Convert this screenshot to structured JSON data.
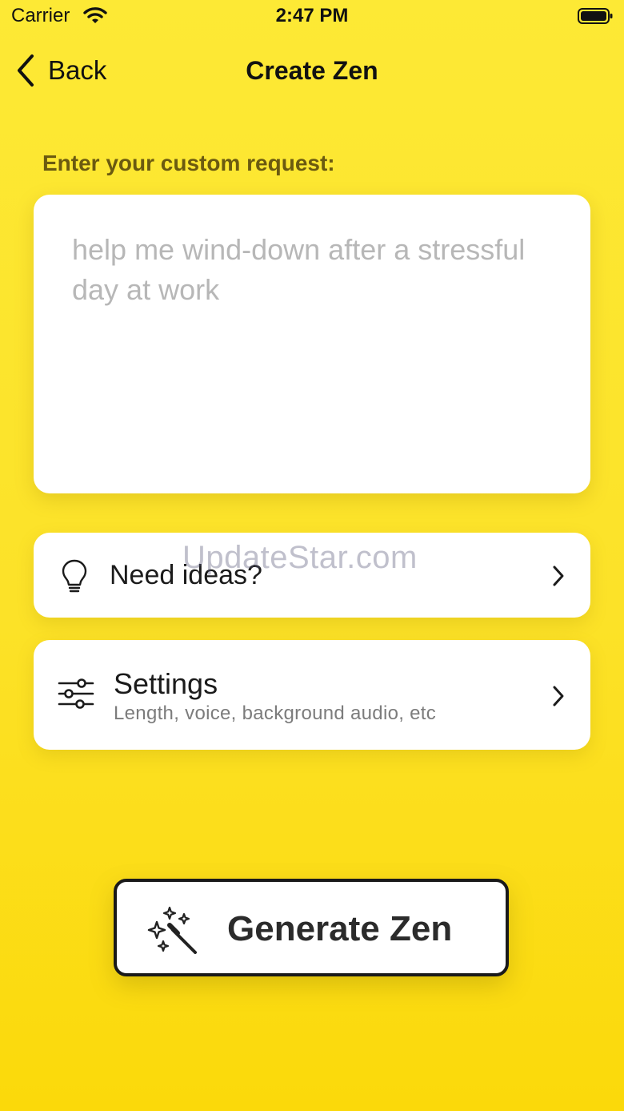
{
  "status_bar": {
    "carrier": "Carrier",
    "time": "2:47 PM"
  },
  "nav": {
    "back_label": "Back",
    "title": "Create Zen"
  },
  "request": {
    "label": "Enter your custom request:",
    "value": "",
    "placeholder": "help me wind-down after a stressful day at work"
  },
  "ideas": {
    "label": "Need ideas?",
    "icon": "lightbulb-icon"
  },
  "settings": {
    "label": "Settings",
    "subtitle": "Length, voice, background audio, etc",
    "icon": "sliders-icon"
  },
  "generate": {
    "label": "Generate Zen",
    "icon": "magic-wand-icon"
  },
  "watermark": "UpdateStar.com",
  "colors": {
    "background": "#fce228",
    "card": "#ffffff",
    "label": "#6b5a10"
  }
}
